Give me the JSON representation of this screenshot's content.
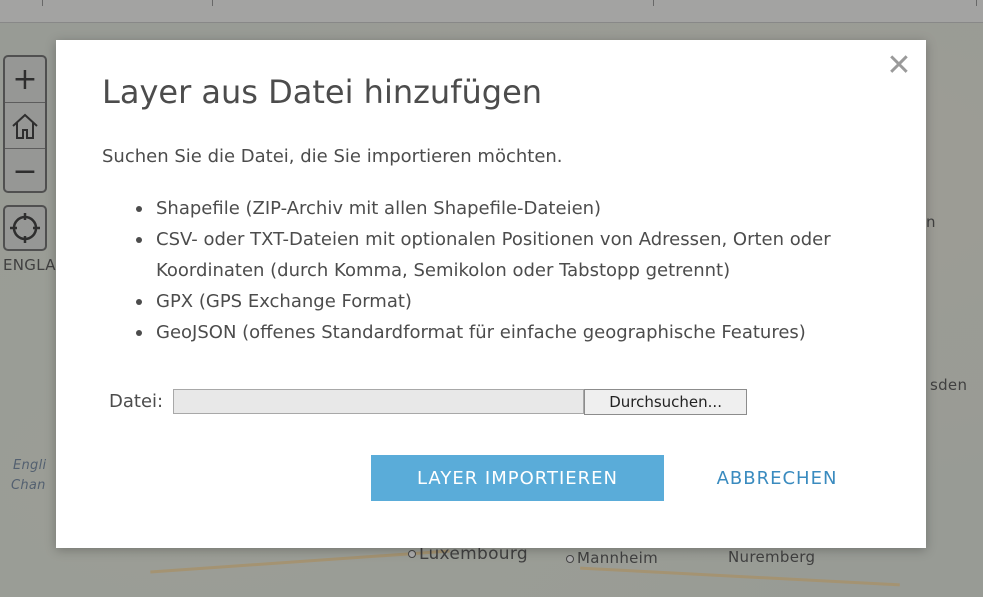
{
  "dialog": {
    "title": "Layer aus Datei hinzufügen",
    "description": "Suchen Sie die Datei, die Sie importieren möchten.",
    "formats": [
      "Shapefile (ZIP-Archiv mit allen Shapefile-Dateien)",
      "CSV- oder TXT-Dateien mit optionalen Positionen von Adressen, Orten oder Koordinaten (durch Komma, Semikolon oder Tabstopp getrennt)",
      "GPX (GPS Exchange Format)",
      "GeoJSON (offenes Standardformat für einfache geographische Features)"
    ],
    "file_label": "Datei:",
    "file_value": "",
    "browse_label": "Durchsuchen...",
    "import_label": "LAYER IMPORTIEREN",
    "cancel_label": "ABBRECHEN",
    "close_glyph": "✕"
  },
  "map": {
    "labels": {
      "engla": "ENGLA",
      "english_channel_1": "Engli",
      "english_channel_2": "Chan",
      "luxembourg": "Luxembourg",
      "mannheim": "Mannheim",
      "nuremberg": "Nuremberg",
      "dresden_partial": "sden",
      "n_partial": "n"
    },
    "controls": {
      "zoom_in": "+",
      "zoom_out": "−"
    }
  },
  "colors": {
    "primary_button": "#5aacd9",
    "link_text": "#3a8bbf",
    "text": "#4c4c4c"
  }
}
